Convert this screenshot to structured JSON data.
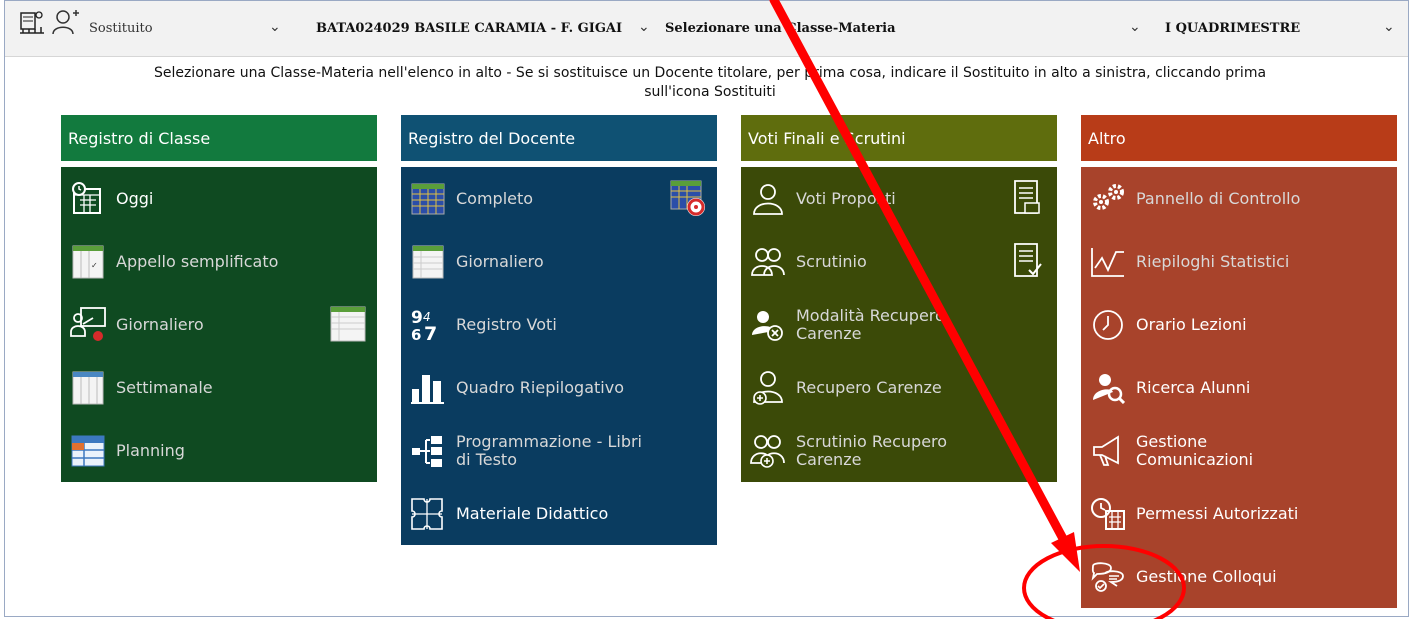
{
  "topbar": {
    "sostituito_label": "Sostituito",
    "school_label": "BATA024029 BASILE CARAMIA - F. GIGAI",
    "class_placeholder": "Selezionare una Classe-Materia",
    "period_label": "I QUADRIMESTRE",
    "chevron": "⌄"
  },
  "instructions": "Selezionare una Classe-Materia nell'elenco in alto - Se si sostituisce un Docente titolare, per prima cosa, indicare il Sostituito in alto a sinistra, cliccando prima sull'icona Sostituiti",
  "columns": [
    {
      "title": "Registro di Classe",
      "items": [
        {
          "label": "Oggi",
          "icon": "calendar-clock-icon"
        },
        {
          "label": "Appello semplificato",
          "icon": "register-icon"
        },
        {
          "label": "Giornaliero",
          "icon": "teacher-board-icon"
        },
        {
          "label": "Settimanale",
          "icon": "weekly-grid-icon"
        },
        {
          "label": "Planning",
          "icon": "planning-table-icon"
        }
      ]
    },
    {
      "title": "Registro del Docente",
      "items": [
        {
          "label": "Completo",
          "icon": "grid-icon"
        },
        {
          "label": "Giornaliero",
          "icon": "sheet-icon"
        },
        {
          "label": "Registro Voti",
          "icon": "numbers-icon"
        },
        {
          "label": "Quadro Riepilogativo",
          "icon": "bar-chart-icon"
        },
        {
          "label": "Programmazione - Libri di Testo",
          "icon": "tree-icon"
        },
        {
          "label": "Materiale Didattico",
          "icon": "puzzle-icon"
        }
      ]
    },
    {
      "title": "Voti Finali e Scrutini",
      "items": [
        {
          "label": "Voti Proposti",
          "icon": "user-outline-icon"
        },
        {
          "label": "Scrutinio",
          "icon": "users-outline-icon"
        },
        {
          "label": "Modalità Recupero Carenze",
          "icon": "recovery-icon"
        },
        {
          "label": "Recupero Carenze",
          "icon": "user-plus-icon"
        },
        {
          "label": "Scrutinio Recupero Carenze",
          "icon": "users-plus-icon"
        }
      ]
    },
    {
      "title": "Altro",
      "items": [
        {
          "label": "Pannello di Controllo",
          "icon": "gears-icon"
        },
        {
          "label": "Riepiloghi Statistici",
          "icon": "line-chart-icon"
        },
        {
          "label": "Orario Lezioni",
          "icon": "clock-icon"
        },
        {
          "label": "Ricerca Alunni",
          "icon": "user-search-icon"
        },
        {
          "label": "Gestione Comunicazioni",
          "icon": "megaphone-icon"
        },
        {
          "label": "Permessi Autorizzati",
          "icon": "permission-clock-icon"
        },
        {
          "label": "Gestione Colloqui",
          "icon": "chat-bubbles-icon"
        }
      ]
    }
  ],
  "annotation": {
    "arrow_color": "#ff0000",
    "circle_color": "#ff0000"
  }
}
